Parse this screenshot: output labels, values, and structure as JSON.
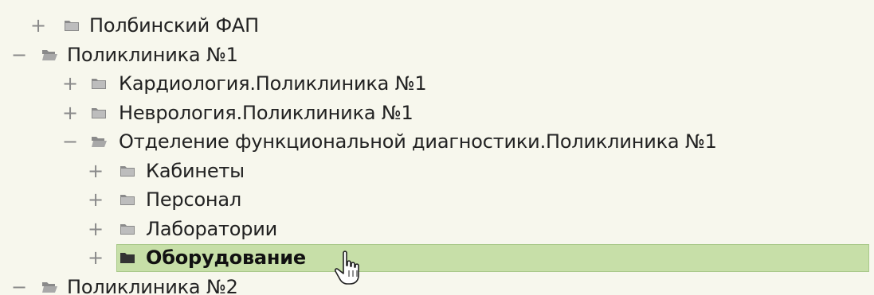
{
  "tree": {
    "items": [
      {
        "toggle": "+",
        "label": "Полбинский ФАП",
        "icon": "folder-closed-icon"
      },
      {
        "toggle": "−",
        "label": "Поликлиника №1",
        "icon": "folder-open-icon"
      },
      {
        "toggle": "+",
        "label": "Кардиология.Поликлиника №1",
        "icon": "folder-closed-icon"
      },
      {
        "toggle": "+",
        "label": "Неврология.Поликлиника №1",
        "icon": "folder-closed-icon"
      },
      {
        "toggle": "−",
        "label": "Отделение функциональной диагностики.Поликлиника №1",
        "icon": "folder-open-icon"
      },
      {
        "toggle": "+",
        "label": "Кабинеты",
        "icon": "folder-closed-icon"
      },
      {
        "toggle": "+",
        "label": "Персонал",
        "icon": "folder-closed-icon"
      },
      {
        "toggle": "+",
        "label": "Лаборатории",
        "icon": "folder-closed-icon"
      },
      {
        "toggle": "+",
        "label": "Оборудование",
        "icon": "folder-closed-icon",
        "selected": true
      },
      {
        "toggle": "−",
        "label": "Поликлиника №2",
        "icon": "folder-open-icon"
      }
    ]
  },
  "colors": {
    "background": "#f7f7ed",
    "selection": "#c7dfa8",
    "toggle": "#8a8a8a",
    "folder": "#8a8a8a"
  }
}
